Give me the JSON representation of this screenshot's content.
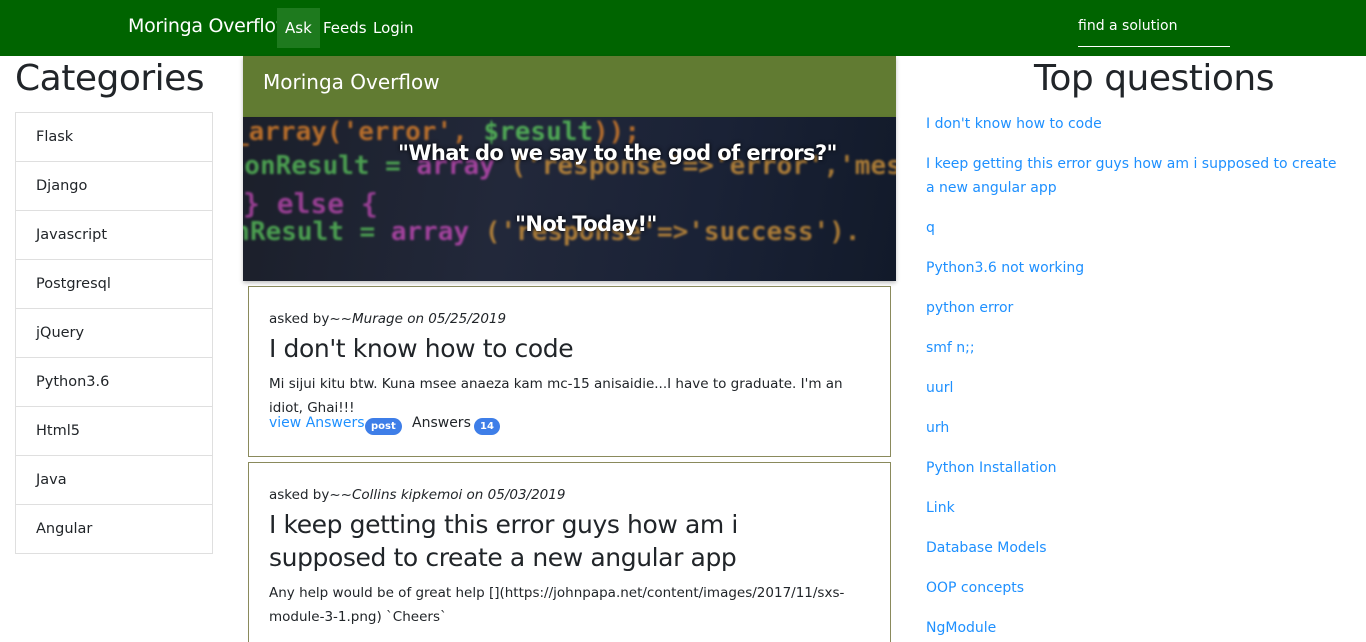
{
  "navbar": {
    "brand": "Moringa Overflow",
    "links": [
      "Ask",
      "Feeds",
      "Login"
    ],
    "search_placeholder": "find a solution"
  },
  "categories": {
    "title": "Categories",
    "items": [
      "Flask",
      "Django",
      "Javascript",
      "Postgresql",
      "jQuery",
      "Python3.6",
      "Html5",
      "Java",
      "Angular"
    ]
  },
  "hero": {
    "title": "Moringa Overflow",
    "quote_line1": "\"What do we say to the god of errors?\"",
    "quote_line2": "\"Not Today!\""
  },
  "questions": [
    {
      "asked_prefix": "asked by~~",
      "author_date": "Murage on 05/25/2019",
      "title": "I don't know how to code",
      "body": "Mi sijui kitu btw. Kuna msee anaeza kam mc-15 anisaidie...I have to graduate. I'm an idiot, Ghai!!!",
      "view_label": "view Answers",
      "badge": "post",
      "answers_label": "Answers",
      "answers_count": "14"
    },
    {
      "asked_prefix": "asked by~~",
      "author_date": "Collins kipkemoi on 05/03/2019",
      "title": "I keep getting this error guys how am i supposed to create a new angular app",
      "body": "Any help would be of great help [](https://johnpapa.net/content/images/2017/11/sxs-module-3-1.png) `Cheers`"
    }
  ],
  "top_questions": {
    "title": "Top questions",
    "items": [
      "I don't know how to code",
      "I keep getting this error guys how am i supposed to create a new angular app",
      "q",
      "Python3.6 not working",
      "python error",
      "smf n;;",
      "uurl",
      "urh",
      "Python Installation",
      "Link",
      "Database Models",
      "OOP concepts",
      "NgModule"
    ]
  },
  "colors": {
    "navbar": "#006400",
    "hero_header": "#617b32",
    "link": "#1e90ff",
    "badge": "#3e7ee8"
  }
}
